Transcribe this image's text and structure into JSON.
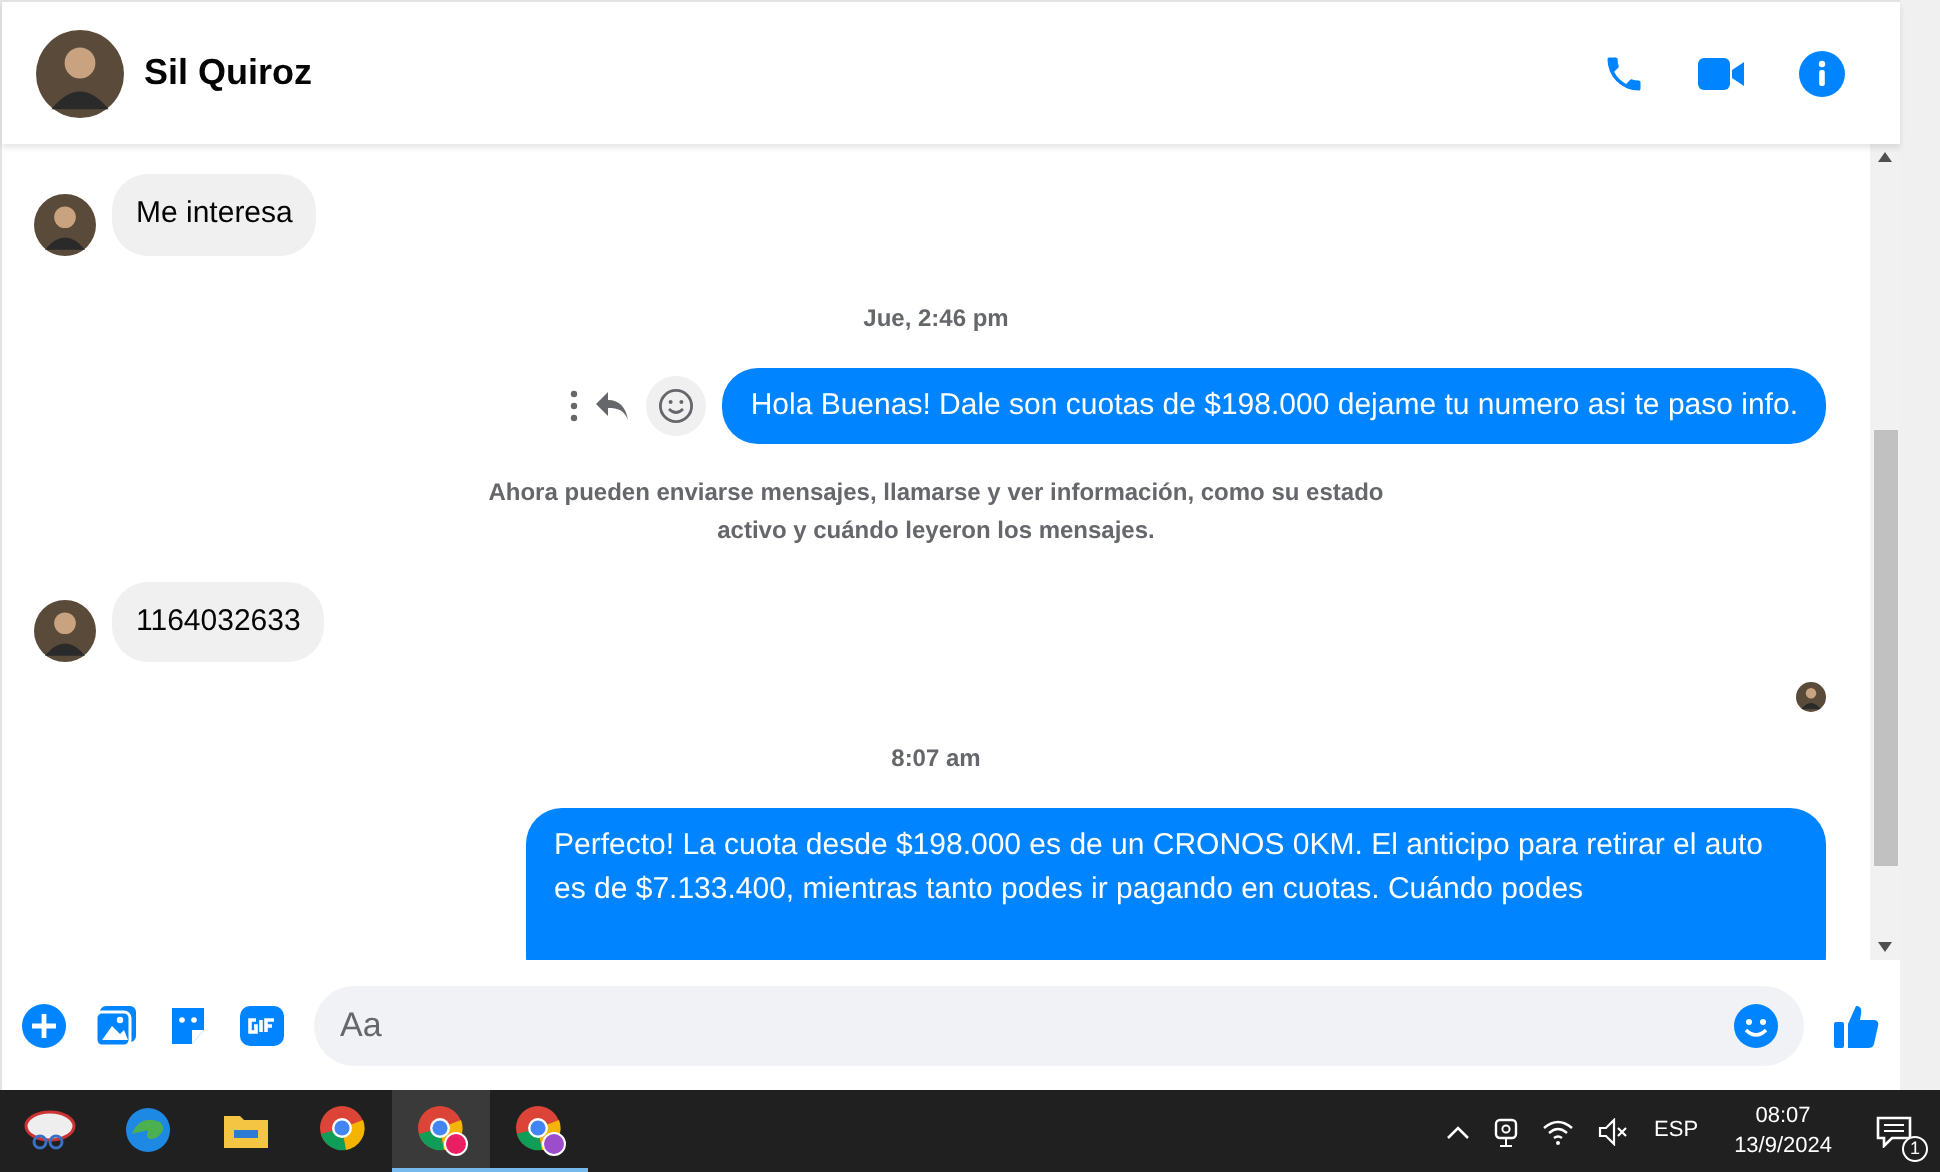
{
  "header": {
    "contact_name": "Sil Quiroz"
  },
  "messages": [
    {
      "kind": "incoming",
      "text": "Me interesa"
    },
    {
      "kind": "timestamp",
      "text": "Jue, 2:46 pm"
    },
    {
      "kind": "outgoing",
      "text": "Hola Buenas! Dale son cuotas de $198.000 dejame tu numero asi te paso info.",
      "hovered": true
    },
    {
      "kind": "notice",
      "text": "Ahora pueden enviarse mensajes, llamarse y ver información, como su estado activo y cuándo leyeron los mensajes."
    },
    {
      "kind": "incoming",
      "text": "1164032633"
    },
    {
      "kind": "seen"
    },
    {
      "kind": "timestamp",
      "text": "8:07 am"
    },
    {
      "kind": "outgoing",
      "text": "Perfecto! La cuota desde $198.000 es de un CRONOS 0KM. El anticipo para retirar el auto es de $7.133.400, mientras tanto podes ir pagando en cuotas. Cuándo podes",
      "hovered": false
    }
  ],
  "composer": {
    "placeholder": "Aa"
  },
  "taskbar": {
    "apps": [
      {
        "kind": "snip",
        "running": false,
        "selected": false
      },
      {
        "kind": "edge",
        "running": false,
        "selected": false
      },
      {
        "kind": "folder",
        "running": false,
        "selected": false
      },
      {
        "kind": "chrome",
        "running": false,
        "selected": false
      },
      {
        "kind": "chrome-profile-c",
        "running": true,
        "selected": true
      },
      {
        "kind": "chrome-profile-lock",
        "running": true,
        "selected": false
      }
    ],
    "language": "ESP",
    "time": "08:07",
    "date": "13/9/2024",
    "notification_count": "1"
  }
}
